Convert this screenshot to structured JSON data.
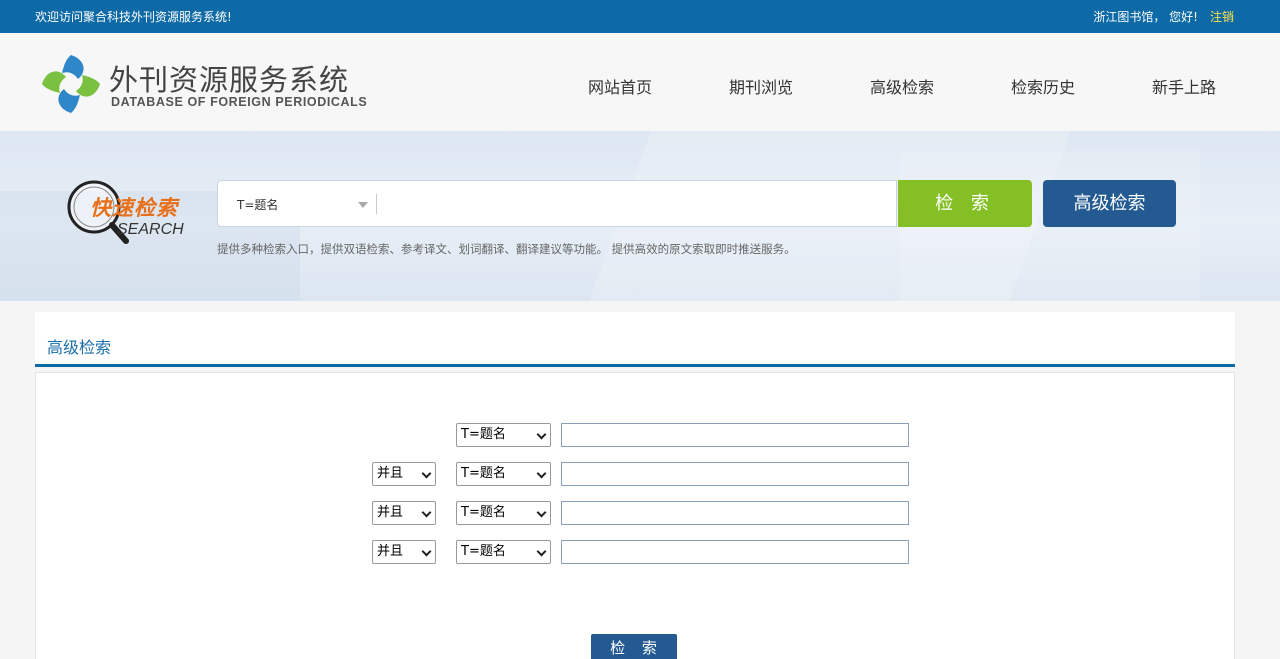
{
  "topbar": {
    "welcome": "欢迎访问聚合科技外刊资源服务系统!",
    "user_greeting": "浙江图书馆， 您好!",
    "logout": "注销"
  },
  "brand": {
    "title": "外刊资源服务系统",
    "subtitle": "DATABASE OF FOREIGN PERIODICALS"
  },
  "nav": [
    {
      "label": "网站首页"
    },
    {
      "label": "期刊浏览"
    },
    {
      "label": "高级检索"
    },
    {
      "label": "检索历史"
    },
    {
      "label": "新手上路"
    }
  ],
  "quick_search": {
    "title": "快速检索",
    "subtitle": "SEARCH",
    "field_selected": "T=题名",
    "query_value": "",
    "search_button": "检 索",
    "advanced_button": "高级检索",
    "description": "提供多种检索入口，提供双语检索、参考译文、划词翻译、翻译建议等功能。 提供高效的原文索取即时推送服务。"
  },
  "advanced": {
    "title": "高级检索",
    "rows": [
      {
        "logic": "",
        "field": "T=题名",
        "value": ""
      },
      {
        "logic": "并且",
        "field": "T=题名",
        "value": ""
      },
      {
        "logic": "并且",
        "field": "T=题名",
        "value": ""
      },
      {
        "logic": "并且",
        "field": "T=题名",
        "value": ""
      }
    ],
    "submit_button": "检 索"
  },
  "colors": {
    "topbar": "#0e6aa6",
    "search_button": "#85bf26",
    "advanced_button": "#245a92",
    "quick_search_title": "#e8701a"
  }
}
